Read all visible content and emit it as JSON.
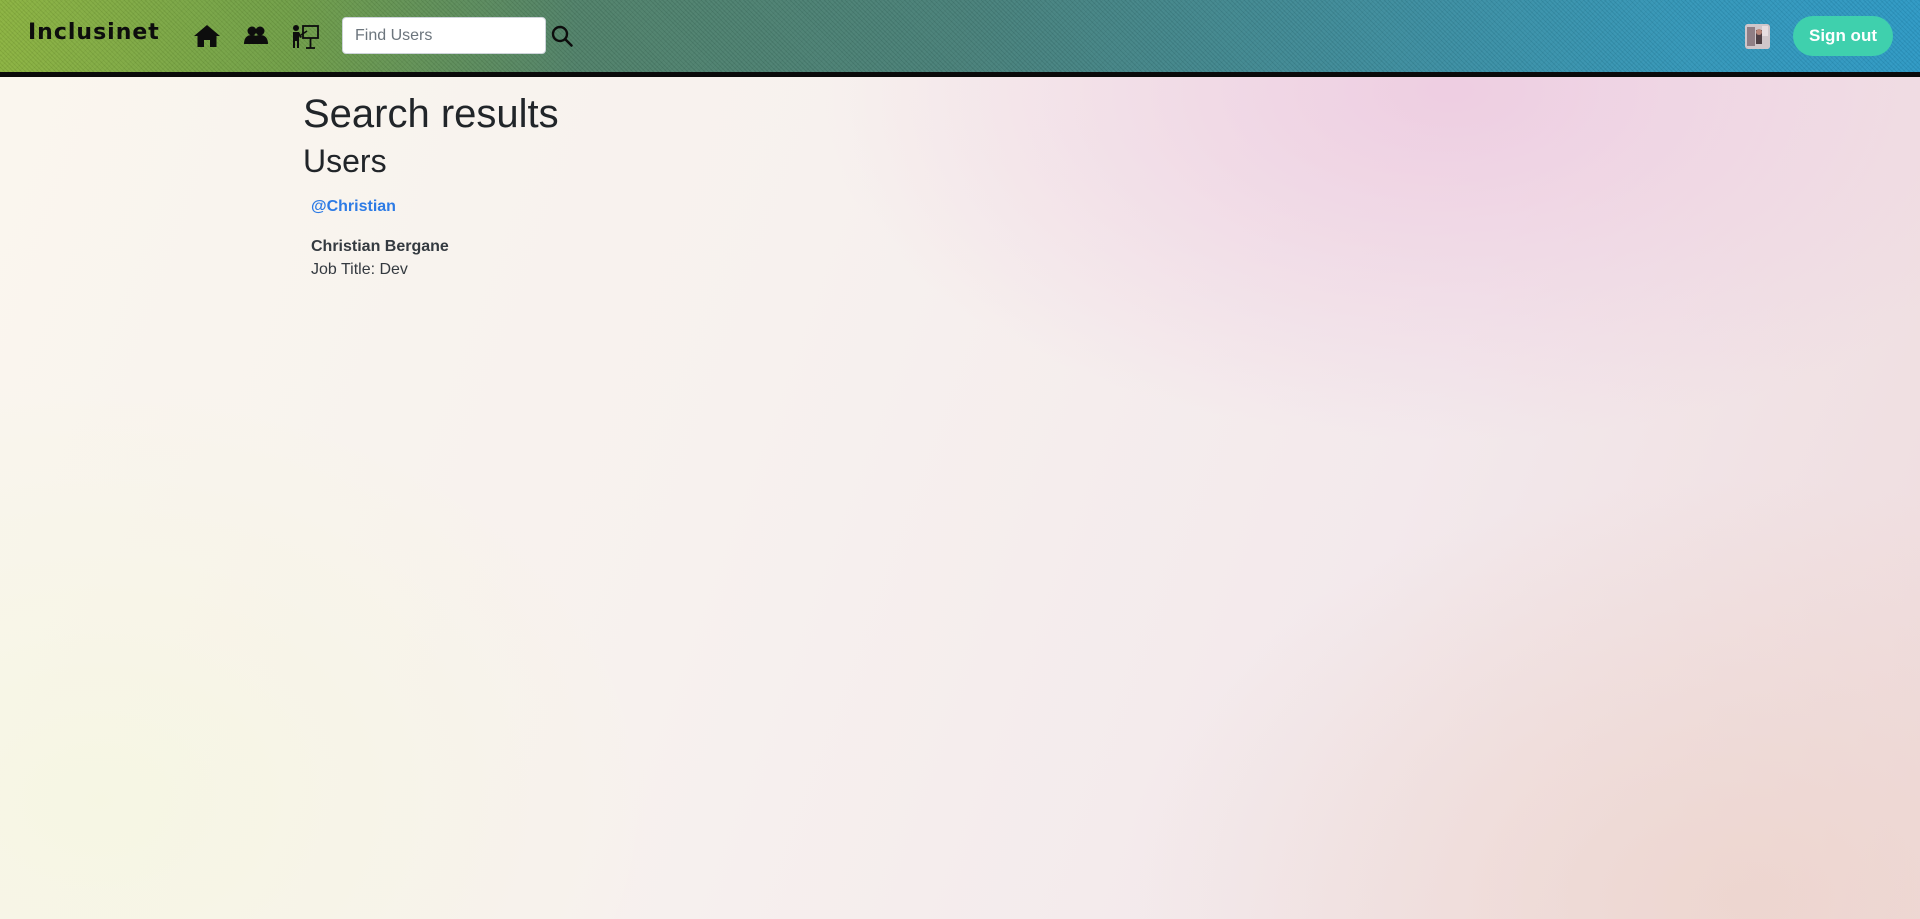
{
  "header": {
    "brand": "Inclusinet",
    "nav_icons": [
      "home-icon",
      "groups-icon",
      "mentor-icon"
    ],
    "search": {
      "placeholder": "Find Users",
      "value": ""
    },
    "sign_out_label": "Sign out",
    "colors": {
      "sign_out_bg": "#3fd0ad",
      "bar_border": "#0a0a0a"
    }
  },
  "main": {
    "page_title": "Search results",
    "section_title": "Users",
    "results": [
      {
        "handle": "@Christian",
        "name": "Christian Bergane",
        "job_title": "Job Title: Dev"
      }
    ],
    "colors": {
      "link": "#2c7be5"
    }
  }
}
